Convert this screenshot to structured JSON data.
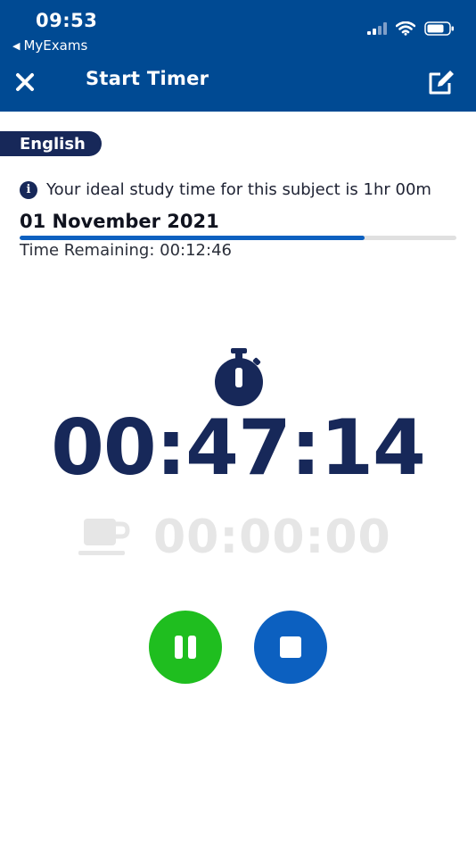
{
  "status_bar": {
    "time": "09:53",
    "back_label": "MyExams"
  },
  "header": {
    "title": "Start Timer",
    "close_icon": "close-icon",
    "edit_icon": "edit-icon"
  },
  "subject": "English",
  "info": {
    "icon": "info-icon",
    "text": "Your ideal study time for this subject is 1hr 00m"
  },
  "date": "01 November 2021",
  "progress": {
    "fraction": 0.79,
    "remaining_text": "Time Remaining: 00:12:46"
  },
  "timer": {
    "study_time": "00:47:14",
    "break_time": "00:00:00",
    "study_icon": "stopwatch-icon",
    "break_icon": "coffee-cup-icon"
  },
  "controls": {
    "pause_icon": "pause-icon",
    "stop_icon": "stop-icon"
  },
  "colors": {
    "header": "#004a93",
    "navy": "#172859",
    "progress": "#0c60c0",
    "pause": "#1fbe1f",
    "stop": "#0c60c0",
    "inactive": "#e6e6e6"
  }
}
